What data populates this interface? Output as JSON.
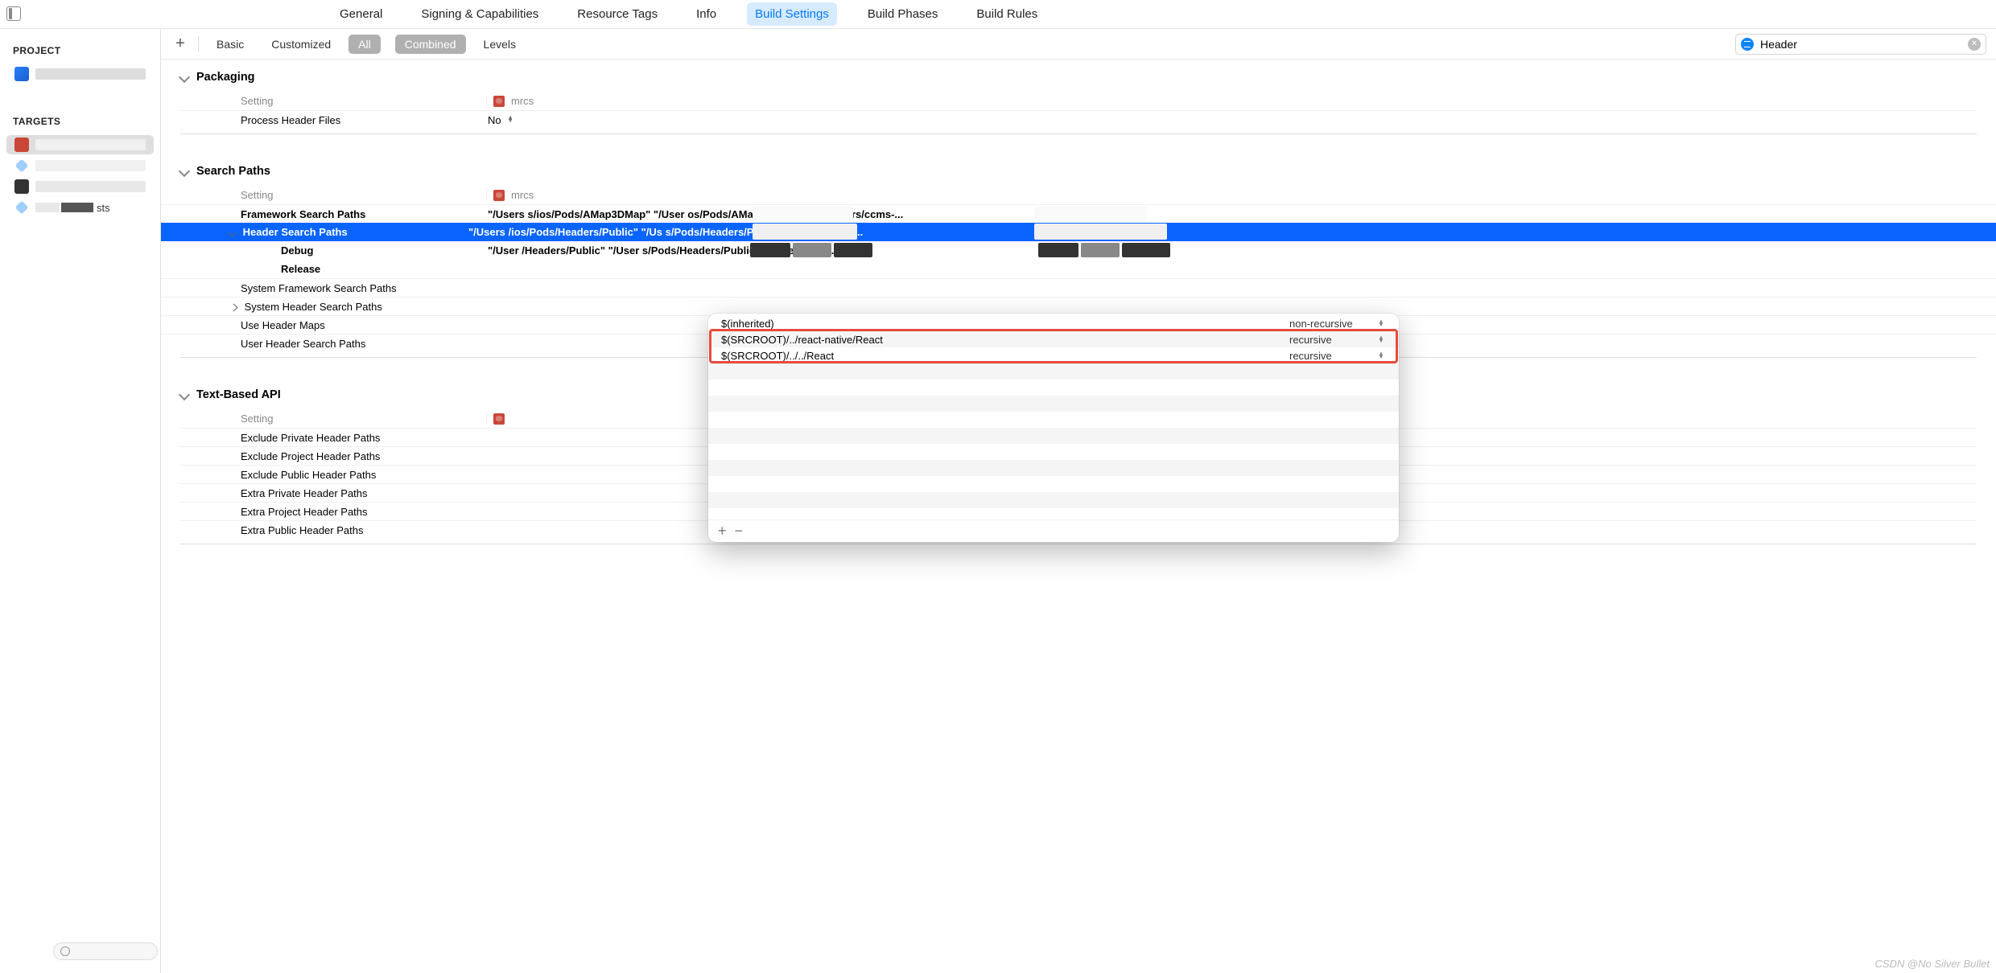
{
  "tabs": [
    "General",
    "Signing & Capabilities",
    "Resource Tags",
    "Info",
    "Build Settings",
    "Build Phases",
    "Build Rules"
  ],
  "active_tab_index": 4,
  "sidebar": {
    "project_header": "PROJECT",
    "targets_header": "TARGETS",
    "target_label_3": "sts"
  },
  "filter_toolbar": {
    "basic": "Basic",
    "customized": "Customized",
    "all": "All",
    "combined": "Combined",
    "levels": "Levels"
  },
  "search": {
    "value": "Header"
  },
  "sections": {
    "packaging": {
      "title": "Packaging",
      "setting_col": "Setting",
      "target_name": "mrcs",
      "rows": [
        {
          "name": "Process Header Files",
          "value": "No"
        }
      ]
    },
    "search_paths": {
      "title": "Search Paths",
      "setting_col": "Setting",
      "target_name": "mrcs",
      "rows": {
        "framework": {
          "name": "Framework Search Paths",
          "value": "\"/Users                            s/ios/Pods/AMap3DMap\" \"/User                         os/Pods/AMapFoundation\" \"/Users/ccms-..."
        },
        "header": {
          "name": "Header Search Paths",
          "value": "\"/Users                             /ios/Pods/Headers/Public\" \"/Us                         s/Pods/Headers/Public/BVLinearGradi..."
        },
        "debug": {
          "name": "Debug",
          "value": "\"/User                               /Headers/Public\" \"/User                          s/Pods/Headers/Public/BVLinearGradi..."
        },
        "release": {
          "name": "Release",
          "value": ""
        },
        "sys_framework": {
          "name": "System Framework Search Paths",
          "value": ""
        },
        "sys_header": {
          "name": "System Header Search Paths",
          "value": ""
        },
        "use_maps": {
          "name": "Use Header Maps",
          "value": ""
        },
        "user_header": {
          "name": "User Header Search Paths",
          "value": ""
        }
      }
    },
    "text_api": {
      "title": "Text-Based API",
      "setting_col": "Setting",
      "rows": [
        {
          "name": "Exclude Private Header Paths"
        },
        {
          "name": "Exclude Project Header Paths"
        },
        {
          "name": "Exclude Public Header Paths"
        },
        {
          "name": "Extra Private Header Paths"
        },
        {
          "name": "Extra Project Header Paths"
        },
        {
          "name": "Extra Public Header Paths"
        }
      ]
    }
  },
  "popover": {
    "rows": [
      {
        "path": "$(inherited)",
        "recursive": "non-recursive"
      },
      {
        "path": "$(SRCROOT)/../react-native/React",
        "recursive": "recursive"
      },
      {
        "path": "$(SRCROOT)/../../React",
        "recursive": "recursive"
      }
    ]
  },
  "watermark": "CSDN @No Silver Bullet"
}
